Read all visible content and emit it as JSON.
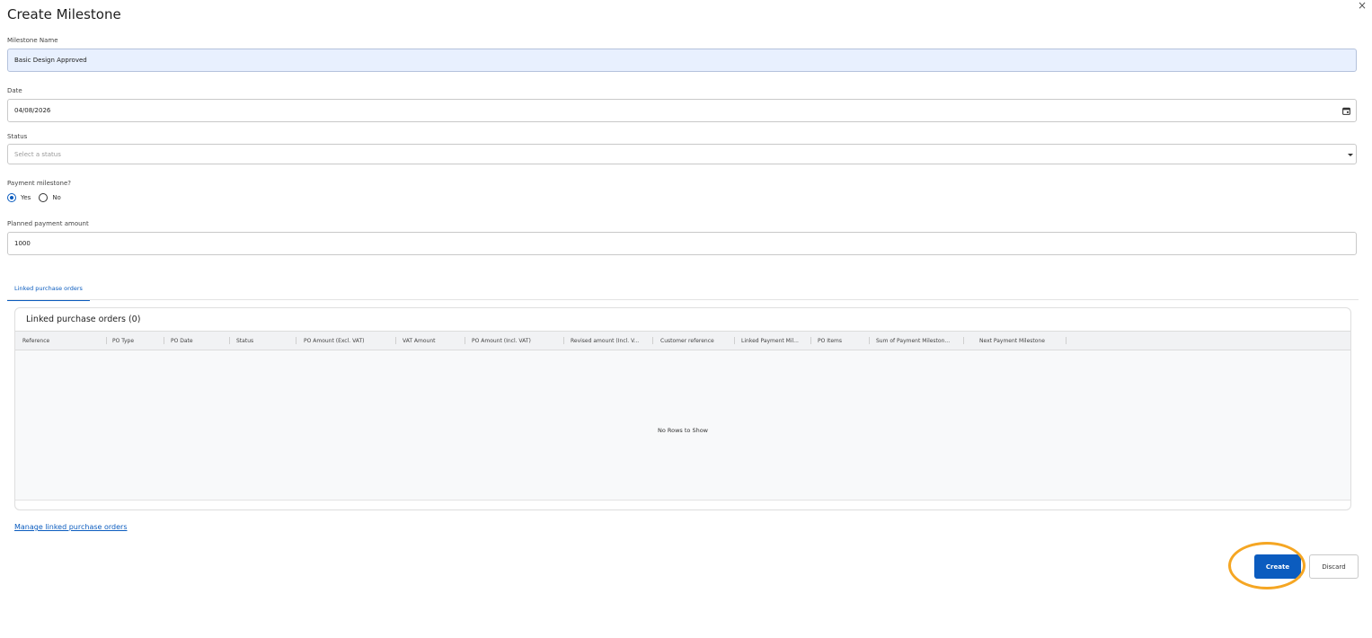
{
  "dialog": {
    "title": "Create Milestone",
    "close_glyph": "×"
  },
  "form": {
    "milestone_name": {
      "label": "Milestone Name",
      "value": "Basic Design Approved"
    },
    "date": {
      "label": "Date",
      "value": "04/08/2026",
      "icon": "calendar-icon"
    },
    "status": {
      "label": "Status",
      "placeholder": "Select a status",
      "icon": "caret-down-icon"
    },
    "payment_milestone": {
      "label": "Payment milestone?",
      "options": [
        {
          "label": "Yes",
          "checked": true
        },
        {
          "label": "No",
          "checked": false
        }
      ]
    },
    "planned_payment_amount": {
      "label": "Planned payment amount",
      "value": "1000"
    }
  },
  "tabs": [
    {
      "label": "Linked purchase orders",
      "active": true
    }
  ],
  "grid": {
    "title": "Linked purchase orders (0)",
    "columns": [
      "Reference",
      "PO Type",
      "PO Date",
      "Status",
      "PO Amount (Excl. VAT)",
      "VAT Amount",
      "PO Amount (Incl. VAT)",
      "Revised amount (Incl. V...",
      "Customer reference",
      "Linked Payment Mil...",
      "PO Items",
      "Sum of Payment Mileston...",
      "Next Payment Milestone"
    ],
    "empty_text": "No Rows to Show"
  },
  "links": {
    "manage": "Manage linked purchase orders"
  },
  "actions": {
    "create": "Create",
    "discard": "Discard"
  },
  "colors": {
    "primary": "#0b5cbf",
    "highlight_ring": "#f5a623",
    "filled_input_bg": "#e8f0fe"
  }
}
